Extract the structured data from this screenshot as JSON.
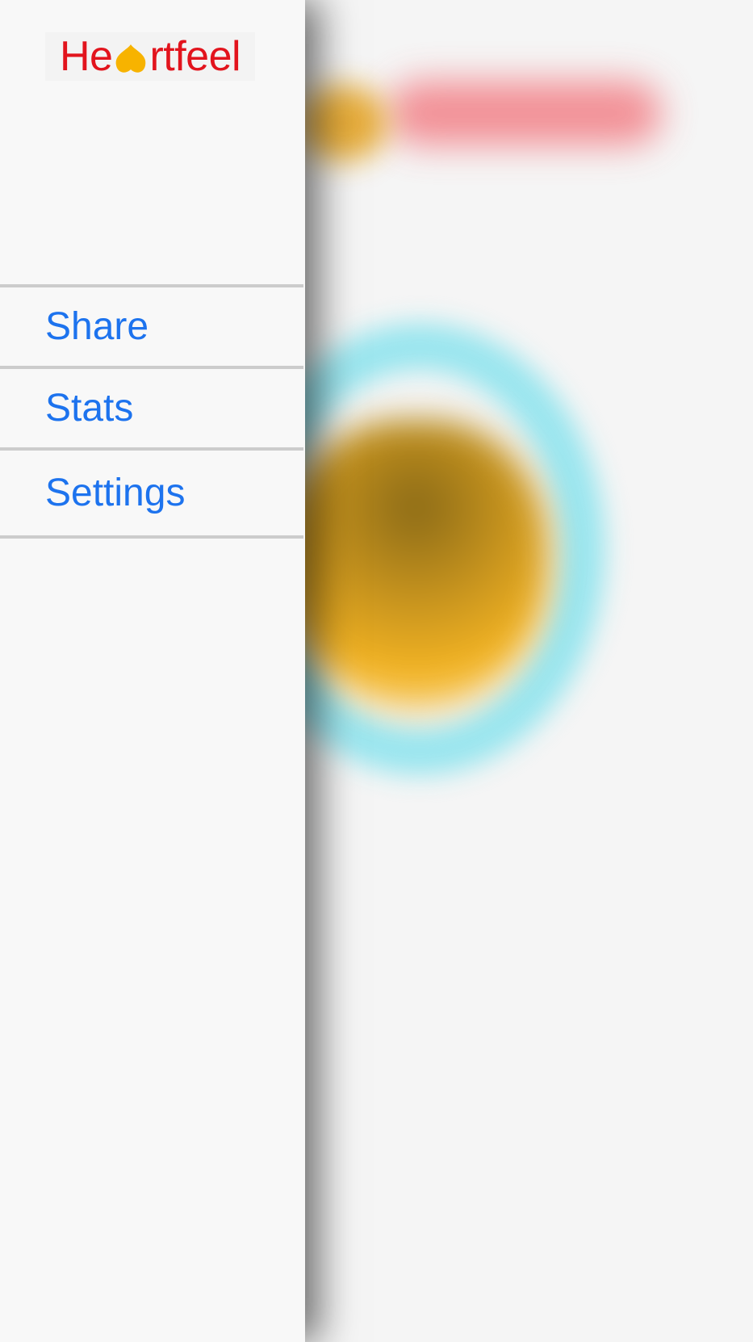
{
  "brand": {
    "logo_left": "He",
    "logo_right": "rtfeel",
    "logo_heart_icon": "heart-icon",
    "text_color": "#e2141d",
    "heart_color": "#f7b300"
  },
  "menu": {
    "items": [
      {
        "label": "Share"
      },
      {
        "label": "Stats"
      },
      {
        "label": "Settings"
      }
    ],
    "link_color": "#1d73ee"
  },
  "background": {
    "state": "blurred"
  }
}
